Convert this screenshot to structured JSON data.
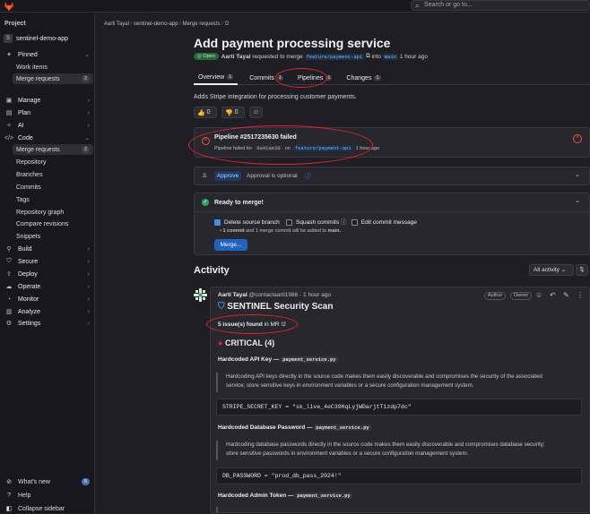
{
  "topbar": {
    "search_placeholder": "Search or go to..."
  },
  "sidebar": {
    "heading": "Project",
    "project_initial": "S",
    "project_name": "sentinel-demo-app",
    "pinned": "Pinned",
    "pinned_items": [
      {
        "label": "Work items"
      },
      {
        "label": "Merge requests",
        "count": "2"
      }
    ],
    "sections": [
      {
        "label": "Manage"
      },
      {
        "label": "Plan"
      },
      {
        "label": "AI"
      },
      {
        "label": "Code"
      }
    ],
    "code_items": [
      {
        "label": "Merge requests",
        "count": "2"
      },
      {
        "label": "Repository"
      },
      {
        "label": "Branches"
      },
      {
        "label": "Commits"
      },
      {
        "label": "Tags"
      },
      {
        "label": "Repository graph"
      },
      {
        "label": "Compare revisions"
      },
      {
        "label": "Snippets"
      }
    ],
    "lower_sections": [
      {
        "label": "Build"
      },
      {
        "label": "Secure"
      },
      {
        "label": "Deploy"
      },
      {
        "label": "Operate"
      },
      {
        "label": "Monitor"
      },
      {
        "label": "Analyze"
      },
      {
        "label": "Settings"
      }
    ],
    "whats_new": "What's new",
    "whats_new_count": "5",
    "help": "Help",
    "collapse": "Collapse sidebar"
  },
  "breadcrumb": {
    "user": "Aarti Tayal",
    "project": "sentinel-demo-app",
    "section": "Merge requests",
    "id": "!2"
  },
  "mr": {
    "title": "Add payment processing service",
    "status": "Open",
    "author": "Aarti Tayal",
    "requested_text": "requested to merge",
    "source_branch": "feature/payment-api",
    "into_text": "into",
    "target_branch": "main",
    "time": "1 hour ago",
    "tabs": [
      {
        "label": "Overview",
        "count": "1"
      },
      {
        "label": "Commits",
        "count": "1"
      },
      {
        "label": "Pipelines",
        "count": "1"
      },
      {
        "label": "Changes",
        "count": "1"
      }
    ],
    "description": "Adds Stripe integration for processing customer payments.",
    "thumbs_up": "0",
    "thumbs_down": "0"
  },
  "pipeline": {
    "title": "Pipeline #2517235630 failed",
    "failed_text": "Pipeline failed for",
    "sha": "6a41ae20",
    "on_text": "on",
    "branch": "feature/payment-api",
    "time": "1 hour ago"
  },
  "approval": {
    "button": "Approve",
    "text": "Approval is optional"
  },
  "merge": {
    "title": "Ready to merge!",
    "delete_branch": "Delete source branch",
    "squash": "Squash commits",
    "edit_msg": "Edit commit message",
    "commit_info_pre": "1 commit",
    "commit_info_mid": "and",
    "commit_info_mid2": "1 merge commit",
    "commit_info_post": "will be added to",
    "commit_info_branch": "main.",
    "button": "Merge..."
  },
  "activity": {
    "heading": "Activity",
    "filter": "All activity",
    "sort": "⇅",
    "note": {
      "author": "Aarti Tayal",
      "handle": "@contactaarti1986",
      "time": "1 hour ago",
      "tag_author": "Author",
      "tag_owner": "Owner",
      "scan_title": "SENTINEL Security Scan",
      "found_bold": "5 issue(s) found",
      "found_rest": "in MR !2",
      "critical": "CRITICAL (4)",
      "issues": [
        {
          "title": "Hardcoded API Key —",
          "file": "payment_service.py",
          "desc1": "Hardcoding API keys directly in the source code makes them easily discoverable and compromises the security of the associated",
          "desc2": "service; store sensitive keys in environment variables or a secure configuration management system.",
          "code": "STRIPE_SECRET_KEY = \"sk_live_4eC39HqLyjWDarjtT1zdp7dc\""
        },
        {
          "title": "Hardcoded Database Password —",
          "file": "payment_service.py",
          "desc1": "Hardcoding database passwords directly in the source code makes them easily discoverable and compromises database security;",
          "desc2": "store sensitive passwords in environment variables or a secure configuration management system.",
          "code": "DB_PASSWORD = \"prod_db_pass_2024!\""
        },
        {
          "title": "Hardcoded Admin Token —",
          "file": "payment_service.py"
        }
      ]
    }
  }
}
